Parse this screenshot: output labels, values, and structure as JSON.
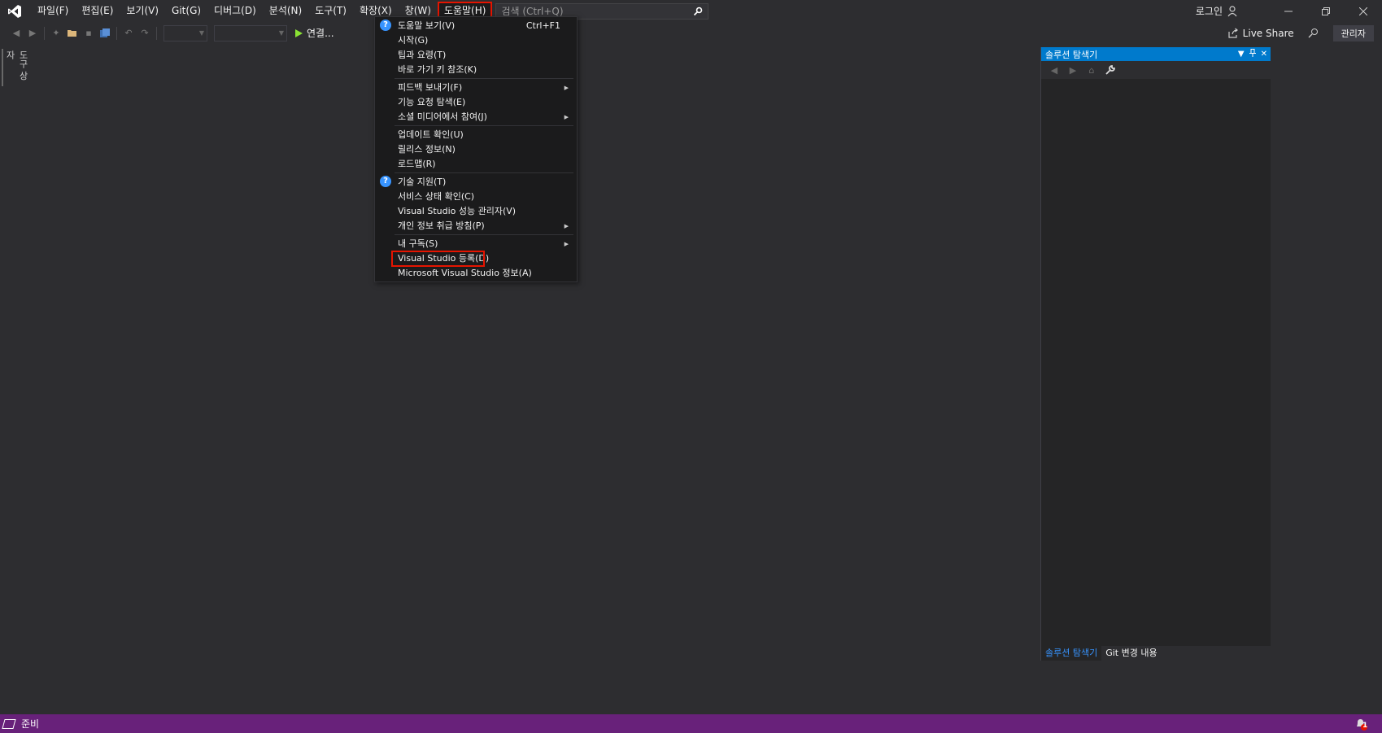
{
  "menu": {
    "file": "파일(F)",
    "edit": "편집(E)",
    "view": "보기(V)",
    "git": "Git(G)",
    "debug": "디버그(D)",
    "analyze": "분석(N)",
    "tools": "도구(T)",
    "extensions": "확장(X)",
    "window": "창(W)",
    "help": "도움말(H)"
  },
  "search": {
    "placeholder": "검색 (Ctrl+Q)"
  },
  "titlebar": {
    "login": "로그인"
  },
  "toolbar": {
    "run_label": "연결...",
    "live_share": "Live Share",
    "admin": "관리자"
  },
  "left_strip": {
    "label": "도구 상자"
  },
  "help_menu": {
    "items": [
      {
        "label": "도움말 보기(V)",
        "accel": "Ctrl+F1"
      },
      {
        "label": "시작(G)"
      },
      {
        "label": "팁과 요령(T)"
      },
      {
        "label": "바로 가기 키 참조(K)"
      },
      {
        "label": "피드백 보내기(F)"
      },
      {
        "label": "기능 요청 탐색(E)"
      },
      {
        "label": "소셜 미디어에서 참여(J)"
      },
      {
        "label": "업데이트 확인(U)"
      },
      {
        "label": "릴리스 정보(N)"
      },
      {
        "label": "로드맵(R)"
      },
      {
        "label": "기술 지원(T)"
      },
      {
        "label": "서비스 상태 확인(C)"
      },
      {
        "label": "Visual Studio 성능 관리자(V)"
      },
      {
        "label": "개인 정보 취급 방침(P)"
      },
      {
        "label": "내 구독(S)"
      },
      {
        "label": "Visual Studio 등록(D)"
      },
      {
        "label": "Microsoft Visual Studio 정보(A)"
      }
    ]
  },
  "solution_explorer": {
    "title": "솔루션 탐색기",
    "tabs": [
      "솔루션 탐색기",
      "Git 변경 내용"
    ]
  },
  "statusbar": {
    "text": "준비",
    "notification_count": "1"
  },
  "colors": {
    "accent": "#007acc",
    "statusbar": "#68217a",
    "highlight_box": "#e51400",
    "info_icon": "#3794ff"
  }
}
